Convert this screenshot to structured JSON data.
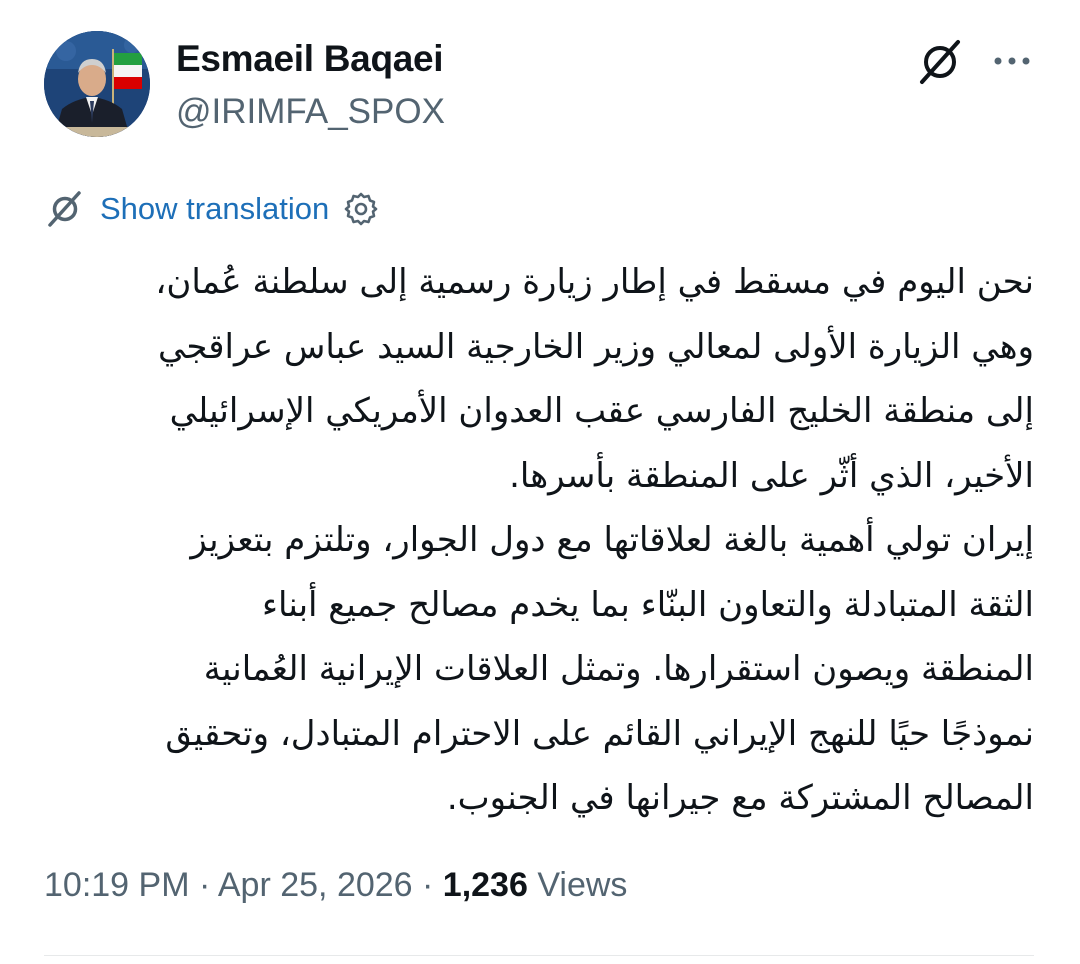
{
  "author": {
    "name": "Esmaeil Baqaei",
    "handle": "@IRIMFA_SPOX"
  },
  "icons": {
    "grok": "grok-icon",
    "more": "more-icon",
    "translate": "grok-icon",
    "settings": "gear-icon"
  },
  "translation": {
    "label": "Show translation"
  },
  "tweet": {
    "lines": [
      "نحن اليوم في مسقط في إطار زيارة رسمية إلى سلطنة عُمان،",
      "وهي الزيارة الأولى لمعالي وزير الخارجية السيد عباس عراقجي",
      "إلى منطقة الخليج الفارسي عقب العدوان الأمريكي الإسرائيلي",
      "الأخير، الذي أثّر على المنطقة بأسرها.",
      "إيران تولي أهمية بالغة لعلاقاتها مع دول الجوار، وتلتزم بتعزيز",
      "الثقة المتبادلة والتعاون البنّاء بما يخدم مصالح جميع أبناء",
      "المنطقة ويصون استقرارها. وتمثل العلاقات الإيرانية العُمانية",
      "نموذجًا حيًا للنهج الإيراني القائم على الاحترام المتبادل، وتحقيق",
      "المصالح المشتركة مع جيرانها في الجنوب."
    ]
  },
  "meta": {
    "time": "10:19 PM",
    "separator": " · ",
    "date": "Apr 25, 2026",
    "views_count": "1,236",
    "views_label": " Views"
  },
  "colors": {
    "text": "#0f1419",
    "secondary": "#536471",
    "link": "#1d6fb8",
    "divider": "#e7e9ea"
  }
}
